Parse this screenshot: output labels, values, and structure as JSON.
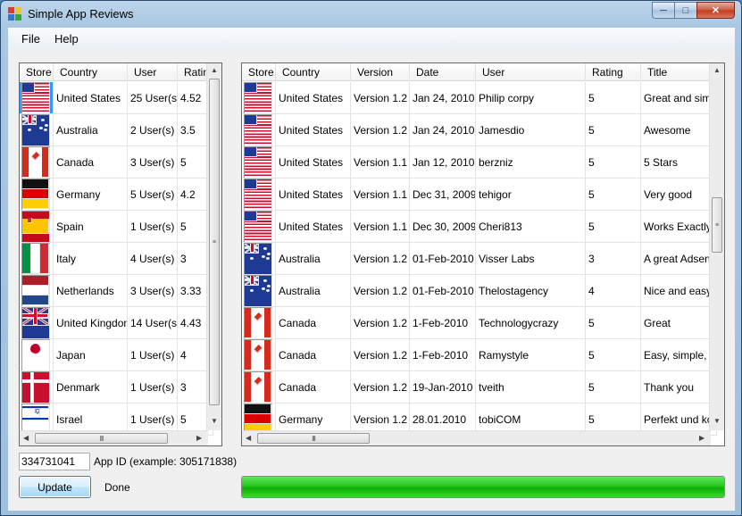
{
  "window": {
    "title": "Simple App Reviews"
  },
  "menu": [
    {
      "label": "File"
    },
    {
      "label": "Help"
    }
  ],
  "colors": {
    "accent": "#3399ff",
    "progress": "#18c010"
  },
  "stores": {
    "columns": [
      "Store",
      "Country",
      "User",
      "Ratin"
    ],
    "rows": [
      {
        "flag": "us",
        "country": "United States",
        "users": "25 User(s)",
        "rating": "4.52"
      },
      {
        "flag": "au",
        "country": "Australia",
        "users": "2 User(s)",
        "rating": "3.5"
      },
      {
        "flag": "ca",
        "country": "Canada",
        "users": "3 User(s)",
        "rating": "5"
      },
      {
        "flag": "de",
        "country": "Germany",
        "users": "5 User(s)",
        "rating": "4.2"
      },
      {
        "flag": "es",
        "country": "Spain",
        "users": "1 User(s)",
        "rating": "5"
      },
      {
        "flag": "it",
        "country": "Italy",
        "users": "4 User(s)",
        "rating": "3"
      },
      {
        "flag": "nl",
        "country": "Netherlands",
        "users": "3 User(s)",
        "rating": "3.33"
      },
      {
        "flag": "gb",
        "country": "United Kingdom",
        "users": "14 User(s)",
        "rating": "4.43"
      },
      {
        "flag": "jp",
        "country": "Japan",
        "users": "1 User(s)",
        "rating": "4"
      },
      {
        "flag": "dk",
        "country": "Denmark",
        "users": "1 User(s)",
        "rating": "3"
      },
      {
        "flag": "il",
        "country": "Israel",
        "users": "1 User(s)",
        "rating": "5"
      }
    ]
  },
  "reviews": {
    "columns": [
      "Store",
      "Country",
      "Version",
      "Date",
      "User",
      "Rating",
      "Title"
    ],
    "rows": [
      {
        "flag": "us",
        "country": "United States",
        "version": "Version 1.2",
        "date": "Jan 24, 2010",
        "user": "Philip corpy",
        "rating": "5",
        "title": "Great and simpl"
      },
      {
        "flag": "us",
        "country": "United States",
        "version": "Version 1.2",
        "date": "Jan 24, 2010",
        "user": "Jamesdio",
        "rating": "5",
        "title": "Awesome"
      },
      {
        "flag": "us",
        "country": "United States",
        "version": "Version 1.1",
        "date": "Jan 12, 2010",
        "user": "berzniz",
        "rating": "5",
        "title": "5 Stars"
      },
      {
        "flag": "us",
        "country": "United States",
        "version": "Version 1.1",
        "date": "Dec 31, 2009",
        "user": "tehigor",
        "rating": "5",
        "title": "Very good"
      },
      {
        "flag": "us",
        "country": "United States",
        "version": "Version 1.1",
        "date": "Dec 30, 2009",
        "user": "Cheri813",
        "rating": "5",
        "title": "Works Exactly ..."
      },
      {
        "flag": "au",
        "country": "Australia",
        "version": "Version 1.2",
        "date": "01-Feb-2010",
        "user": "Visser Labs",
        "rating": "3",
        "title": "A great Adsens"
      },
      {
        "flag": "au",
        "country": "Australia",
        "version": "Version 1.2",
        "date": "01-Feb-2010",
        "user": "Thelostagency",
        "rating": "4",
        "title": "Nice and easy"
      },
      {
        "flag": "ca",
        "country": "Canada",
        "version": "Version 1.2",
        "date": "1-Feb-2010",
        "user": "Technologycrazy",
        "rating": "5",
        "title": "Great"
      },
      {
        "flag": "ca",
        "country": "Canada",
        "version": "Version 1.2",
        "date": "1-Feb-2010",
        "user": "Ramystyle",
        "rating": "5",
        "title": "Easy, simple, st"
      },
      {
        "flag": "ca",
        "country": "Canada",
        "version": "Version 1.2",
        "date": "19-Jan-2010",
        "user": "tveith",
        "rating": "5",
        "title": "Thank you"
      },
      {
        "flag": "de",
        "country": "Germany",
        "version": "Version 1.2",
        "date": "28.01.2010",
        "user": "tobiCOM",
        "rating": "5",
        "title": "Perfekt und kos"
      }
    ]
  },
  "app_id": {
    "value": "334731041",
    "label": "App ID (example: 305171838)"
  },
  "update_button": "Update",
  "status": "Done",
  "progress": {
    "percent": 100
  }
}
